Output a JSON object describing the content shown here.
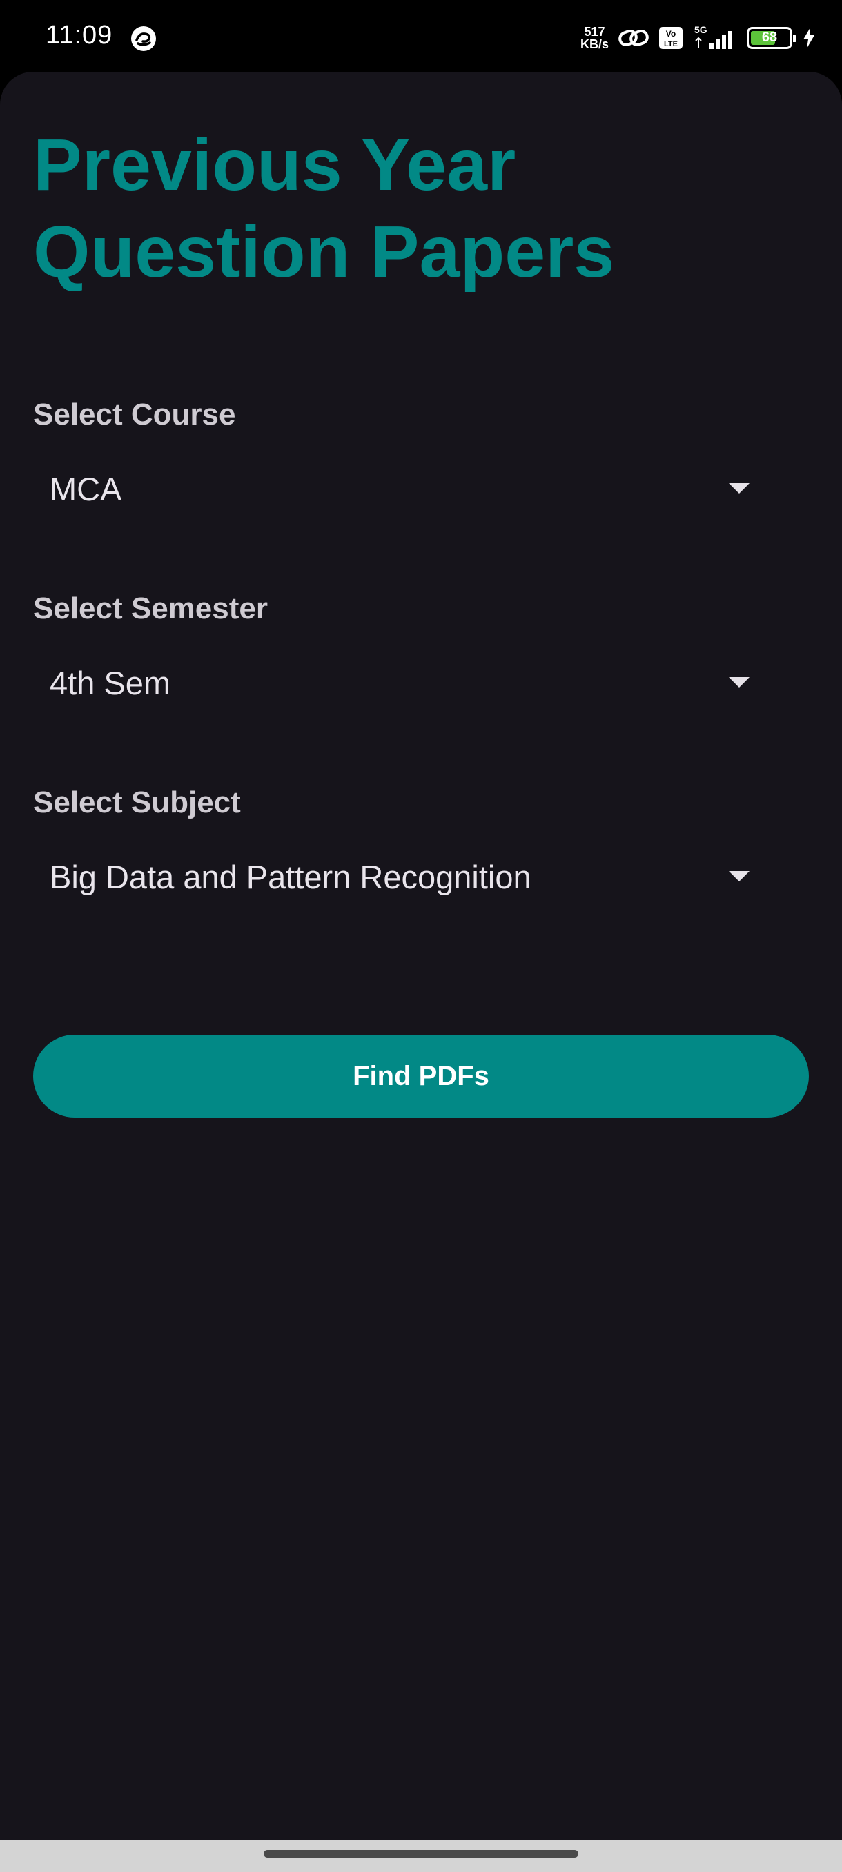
{
  "status_bar": {
    "time": "11:09",
    "net_speed_value": "517",
    "net_speed_unit": "KB/s",
    "volte_label_top": "Vo",
    "volte_label_bottom": "LTE",
    "network_type": "5G",
    "battery_level": "68",
    "battery_fraction": 0.68,
    "battery_color": "#5cc33a",
    "charging": true
  },
  "page": {
    "title": "Previous Year Question Papers",
    "accent_color": "#028986",
    "background_color": "#16141b"
  },
  "form": {
    "course": {
      "label": "Select Course",
      "value": "MCA"
    },
    "semester": {
      "label": "Select Semester",
      "value": "4th Sem"
    },
    "subject": {
      "label": "Select Subject",
      "value": "Big Data and Pattern Recognition"
    },
    "submit_label": "Find PDFs"
  }
}
